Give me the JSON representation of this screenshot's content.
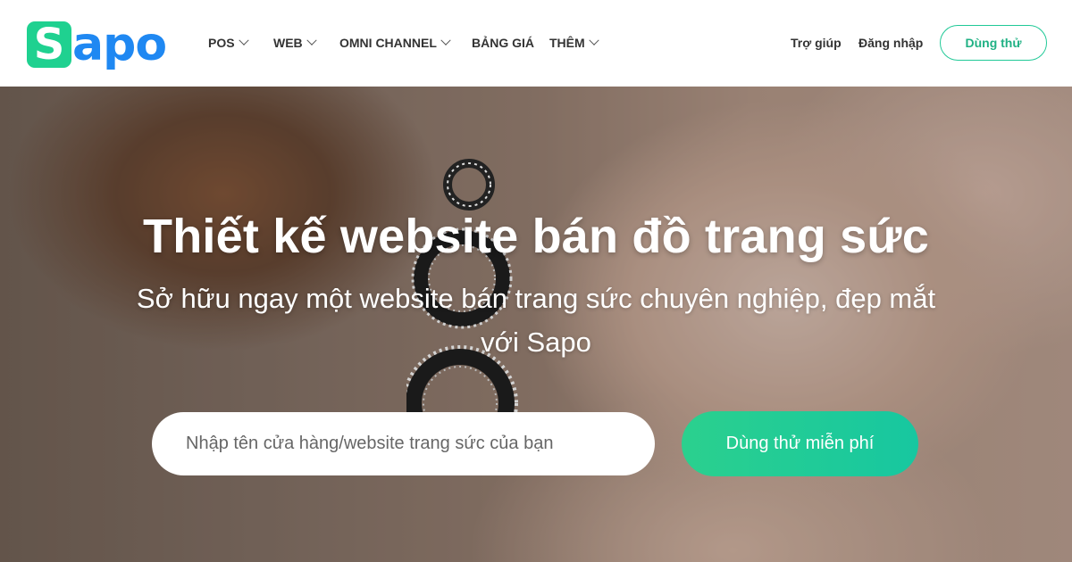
{
  "logo": {
    "text_s": "S",
    "text_rest": "apo",
    "brand_green": "#1fd190",
    "brand_blue": "#1f88f2"
  },
  "nav": {
    "items": [
      {
        "label": "POS",
        "has_dropdown": true
      },
      {
        "label": "WEB",
        "has_dropdown": true
      },
      {
        "label": "OMNI CHANNEL",
        "has_dropdown": true
      },
      {
        "label": "BẢNG GIÁ",
        "has_dropdown": false
      },
      {
        "label": "THÊM",
        "has_dropdown": true
      }
    ],
    "help_label": "Trợ giúp",
    "login_label": "Đăng nhập",
    "try_label": "Dùng thử"
  },
  "hero": {
    "title": "Thiết kế website bán đồ trang sức",
    "subtitle": "Sở hữu ngay một website bán trang sức chuyên nghiệp, đẹp mắt với Sapo",
    "input_placeholder": "Nhập tên cửa hàng/website trang sức của bạn",
    "cta_label": "Dùng thử miễn phí",
    "accent": "#20c997"
  }
}
